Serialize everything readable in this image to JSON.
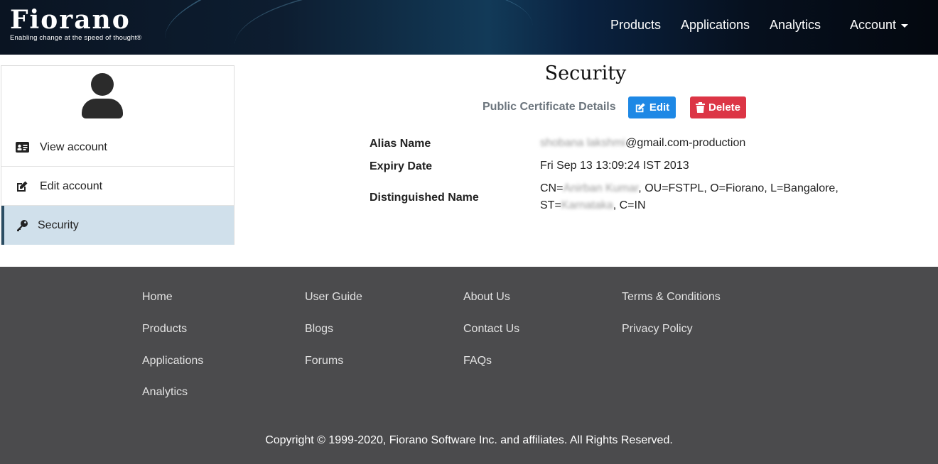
{
  "header": {
    "logo_text": "Fiorano",
    "tagline": "Enabling change at the speed of thought",
    "registered": "®",
    "nav": {
      "products": "Products",
      "applications": "Applications",
      "analytics": "Analytics",
      "account": "Account"
    }
  },
  "sidebar": {
    "items": [
      {
        "label": "View account",
        "icon": "id-card-icon"
      },
      {
        "label": "Edit account",
        "icon": "edit-icon"
      },
      {
        "label": "Security",
        "icon": "key-icon",
        "active": true
      }
    ]
  },
  "main": {
    "title": "Security",
    "section_label": "Public Certificate Details",
    "edit_label": "Edit",
    "delete_label": "Delete",
    "fields": {
      "alias": {
        "label": "Alias Name",
        "value_blurred": "shobana lakshmi",
        "value_suffix": "@gmail.com-production"
      },
      "expiry": {
        "label": "Expiry Date",
        "value": "Fri Sep 13 13:09:24 IST 2013"
      },
      "dn": {
        "label": "Distinguished Name",
        "prefix": "CN=",
        "blurred_cn": "Anirban Kumar",
        "middle": ", OU=FSTPL, O=Fiorano, L=Bangalore,",
        "st_prefix": "ST=",
        "blurred_st": "Karnataka",
        "suffix": ", C=IN"
      }
    }
  },
  "footer": {
    "columns": [
      [
        "Home",
        "Products",
        "Applications",
        "Analytics"
      ],
      [
        "User Guide",
        "Blogs",
        "Forums"
      ],
      [
        "About Us",
        "Contact Us",
        "FAQs"
      ],
      [
        "Terms & Conditions",
        "Privacy Policy"
      ]
    ],
    "copyright": "Copyright © 1999-2020, Fiorano Software Inc. and affiliates. All Rights Reserved."
  },
  "colors": {
    "edit_button": "#1e88e5",
    "delete_button": "#dc3545",
    "active_sidebar_bg": "#d0e0eb",
    "footer_bg": "#4b4b4d"
  }
}
